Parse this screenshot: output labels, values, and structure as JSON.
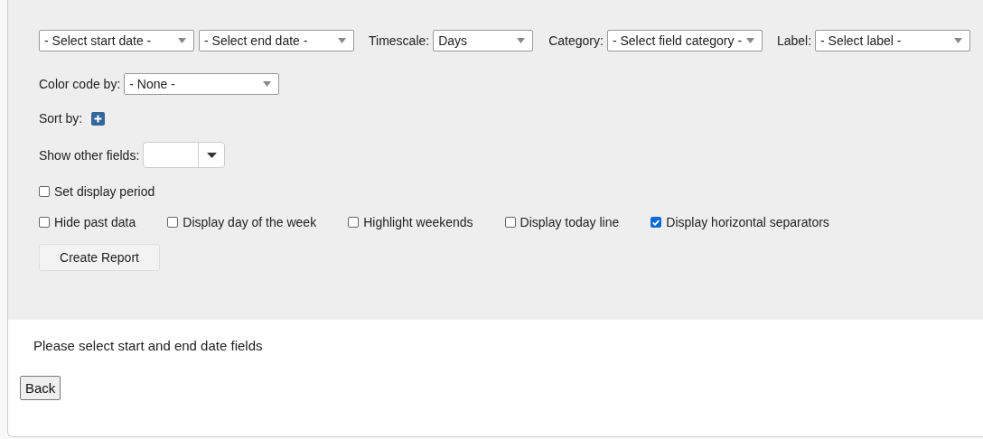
{
  "filters": [
    {
      "value": "- Select start date -"
    },
    {
      "value": "- Select end date -"
    },
    {
      "label": "Timescale:",
      "value": "Days"
    },
    {
      "label": "Category:",
      "value": "- Select field category -"
    },
    {
      "label": "Label:",
      "value": "- Select label -"
    }
  ],
  "color_code": {
    "label": "Color code by:",
    "value": "- None -"
  },
  "sort_by": {
    "label": "Sort by:"
  },
  "show_other_fields": {
    "label": "Show other fields:"
  },
  "display_period": {
    "label": "Set display period",
    "checked": false
  },
  "options": [
    {
      "label": "Hide past data",
      "checked": false
    },
    {
      "label": "Display day of the week",
      "checked": false
    },
    {
      "label": "Highlight weekends",
      "checked": false
    },
    {
      "label": "Display today line",
      "checked": false
    },
    {
      "label": "Display horizontal separators",
      "checked": true
    }
  ],
  "create_button": "Create Report",
  "message": "Please select start and end date fields",
  "back_button": "Back"
}
